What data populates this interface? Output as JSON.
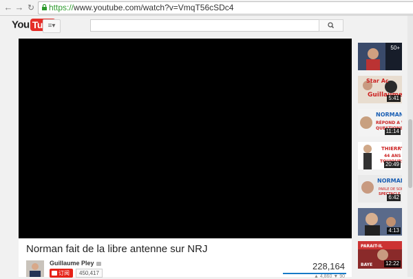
{
  "browser": {
    "url_scheme": "https://",
    "url_rest": "www.youtube.com/watch?v=VmqT56cSDc4"
  },
  "header": {
    "logo_you": "You",
    "logo_tube": "Tube"
  },
  "video": {
    "title": "Norman fait de la libre antenne sur NRJ",
    "channel": "Guillaume Pley",
    "subscribe_label": "订阅",
    "subscriber_count": "450,417",
    "view_count": "228,164",
    "likes": "4,860",
    "dislikes": "90"
  },
  "related": [
    {
      "duration": "",
      "thumb_color": "#3a4a6a",
      "badge": "50+"
    },
    {
      "duration": "5:41",
      "thumb_color": "#d0c0b0",
      "badge": ""
    },
    {
      "duration": "11:14",
      "thumb_color": "#e8e8e8",
      "badge": ""
    },
    {
      "duration": "20:49",
      "thumb_color": "#ffffff",
      "badge": ""
    },
    {
      "duration": "6:42",
      "thumb_color": "#e5e5e5",
      "badge": ""
    },
    {
      "duration": "4:13",
      "thumb_color": "#5a6a8a",
      "badge": ""
    },
    {
      "duration": "12:22",
      "thumb_color": "#8a2a2a",
      "badge": ""
    }
  ],
  "colors": {
    "accent": "#e52d27",
    "subscribe": "#e62117",
    "https": "#2c9a2c",
    "view_bar": "#167ac6"
  }
}
